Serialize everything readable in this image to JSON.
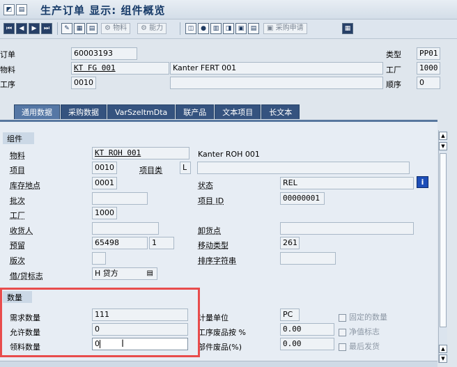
{
  "window": {
    "title": "生产订单 显示: 组件概览",
    "title_icons": [
      "◩",
      "▤"
    ]
  },
  "toolbar": {
    "labels": {
      "material_button": "物料",
      "capacity_button": "能力",
      "purchase_request_button": "采购申请"
    }
  },
  "header": {
    "order_label": "订单",
    "order_value": "60003193",
    "material_label": "物料",
    "material_value": "KT FG 001",
    "material_description": "Kanter FERT 001",
    "operation_label": "工序",
    "operation_value": "0010",
    "type_label": "类型",
    "type_value": "PP01",
    "plant_label": "工厂",
    "plant_value": "1000",
    "sequence_label": "顺序",
    "sequence_value": "0"
  },
  "tabs": [
    "通用数据",
    "采购数据",
    "VarSzeItmDta",
    "联产品",
    "文本项目",
    "长文本"
  ],
  "component_group": {
    "title": "组件",
    "material_label": "物料",
    "material_value": "KT ROH 001",
    "material_description": "Kanter ROH 001",
    "item_label": "项目",
    "item_value": "0010",
    "item_category_label": "项目类",
    "item_category_value": "L",
    "storage_location_label": "库存地点",
    "storage_location_value": "0001",
    "status_label": "状态",
    "status_value": "REL",
    "batch_label": "批次",
    "item_id_label": "项目 ID",
    "item_id_value": "00000001",
    "plant_label": "工厂",
    "plant_value": "1000",
    "receiving_point_label": "收货人",
    "unloading_point_label": "卸货点",
    "reservation_label": "预留",
    "reservation_value": "65498",
    "reservation_item_value": "1",
    "movement_type_label": "移动类型",
    "movement_type_value": "261",
    "version_label": "版次",
    "sort_string_label": "排序字符串",
    "debit_credit_label": "借/贷标志",
    "debit_credit_value": "H 贷方"
  },
  "quantity_group": {
    "title": "数量",
    "required_qty_label": "需求数量",
    "required_qty_value": "111",
    "allowed_qty_label": "允许数量",
    "allowed_qty_value": "0",
    "withdrawn_qty_label": "领料数量",
    "withdrawn_qty_value": "0",
    "unit_label": "计量单位",
    "unit_value": "PC",
    "operation_scrap_label": "工序废品按 %",
    "operation_scrap_value": "0.00",
    "component_scrap_label": "部件废品(%)",
    "component_scrap_value": "0.00",
    "fixed_qty_label": "固定的数量",
    "net_indicator_label": "净值标志",
    "final_issue_label": "最后发货"
  },
  "colors": {
    "accent": "#35537f",
    "highlight_frame": "#e84c4c"
  }
}
